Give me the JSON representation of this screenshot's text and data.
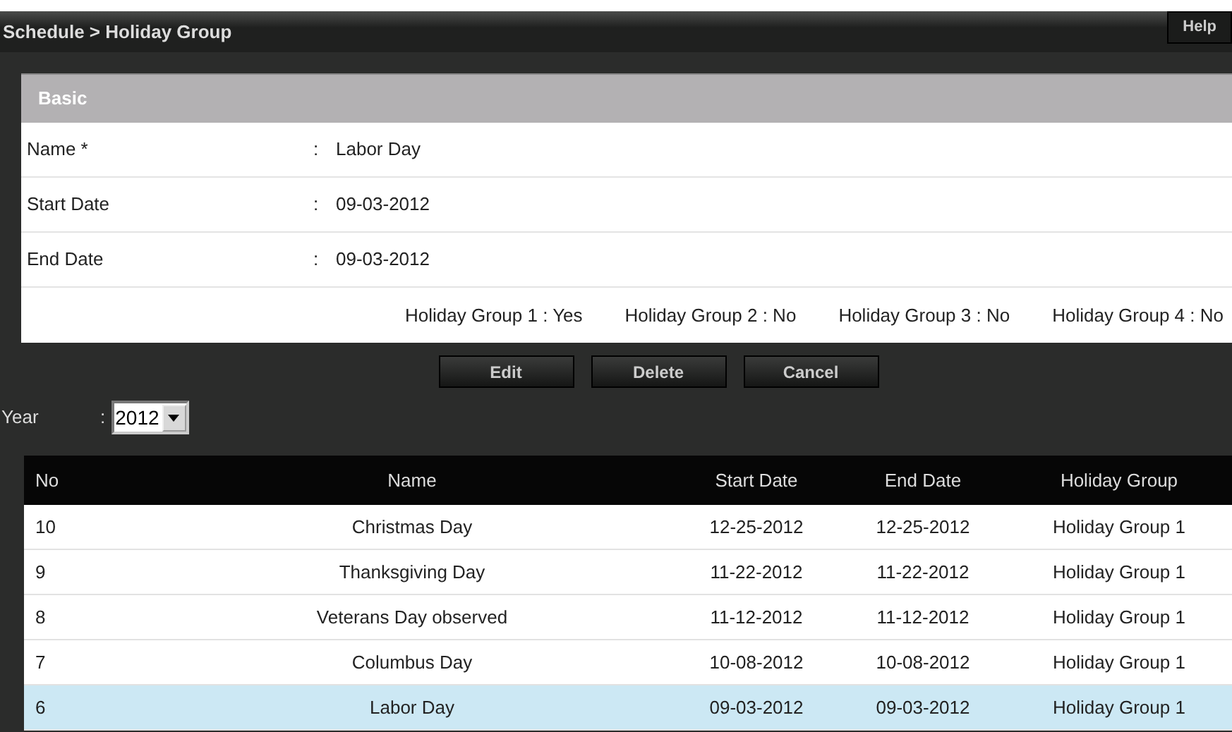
{
  "title": "Schedule > Holiday Group",
  "help_button": "Help",
  "basic": {
    "heading": "Basic",
    "fields": [
      {
        "label": "Name *",
        "separator": ":",
        "value": "Labor Day"
      },
      {
        "label": "Start Date",
        "separator": ":",
        "value": "09-03-2012"
      },
      {
        "label": "End Date",
        "separator": ":",
        "value": "09-03-2012"
      }
    ],
    "groups": [
      "Holiday Group 1 : Yes",
      "Holiday Group 2 : No",
      "Holiday Group 3 : No",
      "Holiday Group 4 : No"
    ]
  },
  "buttons": [
    "Edit",
    "Delete",
    "Cancel"
  ],
  "year": {
    "label": "Year",
    "separator": ":",
    "value": "2012"
  },
  "table": {
    "columns": [
      "No",
      "Name",
      "Start Date",
      "End Date",
      "Holiday Group"
    ],
    "rows": [
      {
        "cells": [
          "10",
          "Christmas Day",
          "12-25-2012",
          "12-25-2012",
          "Holiday Group 1"
        ],
        "selected": false
      },
      {
        "cells": [
          "9",
          "Thanksgiving Day",
          "11-22-2012",
          "11-22-2012",
          "Holiday Group 1"
        ],
        "selected": false
      },
      {
        "cells": [
          "8",
          "Veterans Day observed",
          "11-12-2012",
          "11-12-2012",
          "Holiday Group 1"
        ],
        "selected": false
      },
      {
        "cells": [
          "7",
          "Columbus Day",
          "10-08-2012",
          "10-08-2012",
          "Holiday Group 1"
        ],
        "selected": false
      },
      {
        "cells": [
          "6",
          "Labor Day",
          "09-03-2012",
          "09-03-2012",
          "Holiday Group 1"
        ],
        "selected": true
      }
    ]
  }
}
